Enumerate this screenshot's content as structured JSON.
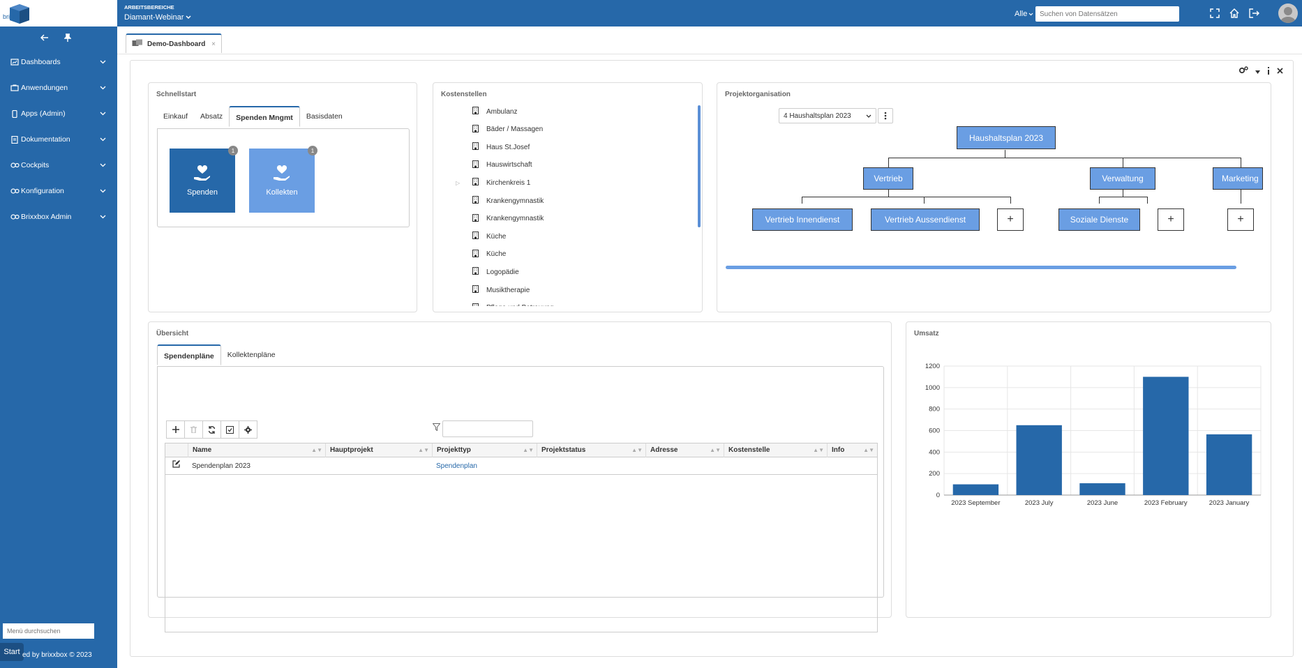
{
  "app": {
    "logo_text": "brixx",
    "footer": "ed by brixxbox © 2023",
    "start_label": "Start",
    "menu_search_placeholder": "Menü durchsuchen"
  },
  "sidebar": {
    "items": [
      {
        "label": "Dashboards",
        "icon": "dashboard-icon"
      },
      {
        "label": "Anwendungen",
        "icon": "apps-icon"
      },
      {
        "label": "Apps (Admin)",
        "icon": "mobile-icon"
      },
      {
        "label": "Dokumentation",
        "icon": "document-icon"
      },
      {
        "label": "Cockpits",
        "icon": "cockpit-icon"
      },
      {
        "label": "Konfiguration",
        "icon": "config-icon"
      },
      {
        "label": "Brixxbox Admin",
        "icon": "admin-icon"
      }
    ]
  },
  "header": {
    "workspace_label": "ARBEITSBEREICHE",
    "workspace_name": "Diamant-Webinar",
    "scope": "Alle",
    "search_placeholder": "Suchen von Datensätzen"
  },
  "tabbar": {
    "tab_label": "Demo-Dashboard"
  },
  "schnellstart": {
    "title": "Schnellstart",
    "tabs": [
      "Einkauf",
      "Absatz",
      "Spenden Mngmt",
      "Basisdaten"
    ],
    "active_tab": 2,
    "tiles": [
      {
        "label": "Spenden",
        "badge": "1",
        "color": "#2668a9"
      },
      {
        "label": "Kollekten",
        "badge": "1",
        "color": "#6a9ee3"
      }
    ]
  },
  "kostenstellen": {
    "title": "Kostenstellen",
    "items": [
      "Ambulanz",
      "Bäder / Massagen",
      "Haus St.Josef",
      "Hauswirtschaft",
      "Kirchenkreis 1",
      "Krankengymnastik",
      "Krankengymnastik",
      "Küche",
      "Küche",
      "Logopädie",
      "Musiktherapie",
      "Pflege und Betreuung"
    ]
  },
  "projektorganisation": {
    "title": "Projektorganisation",
    "select_value": "4 Haushaltsplan 2023",
    "root": "Haushaltsplan 2023",
    "level1": [
      "Vertrieb",
      "Verwaltung",
      "Marketing"
    ],
    "level2": [
      "Vertrieb Innendienst",
      "Vertrieb Aussendienst",
      "Soziale Dienste"
    ],
    "add_symbol": "+"
  },
  "uebersicht": {
    "title": "Übersicht",
    "tabs": [
      "Spendenpläne",
      "Kollektenpläne"
    ],
    "active_tab": 0,
    "columns": [
      "Name",
      "Hauptprojekt",
      "Projekttyp",
      "Projektstatus",
      "Adresse",
      "Kostenstelle",
      "Info"
    ],
    "rows": [
      {
        "name": "Spendenplan 2023",
        "hauptprojekt": "",
        "projekttyp": "Spendenplan",
        "projektstatus": "",
        "adresse": "",
        "kostenstelle": "",
        "info": ""
      }
    ]
  },
  "umsatz": {
    "title": "Umsatz"
  },
  "chart_data": {
    "type": "bar",
    "title": "Umsatz",
    "categories": [
      "2023 September",
      "2023 July",
      "2023 June",
      "2023 February",
      "2023 January"
    ],
    "values": [
      100,
      650,
      110,
      1100,
      565
    ],
    "yticks": [
      0,
      200,
      400,
      600,
      800,
      1000,
      1200
    ],
    "ylim": [
      0,
      1200
    ],
    "grid": true,
    "color": "#2668a9"
  },
  "colors": {
    "brand": "#2668a9",
    "accent_light": "#6a9ee3"
  }
}
